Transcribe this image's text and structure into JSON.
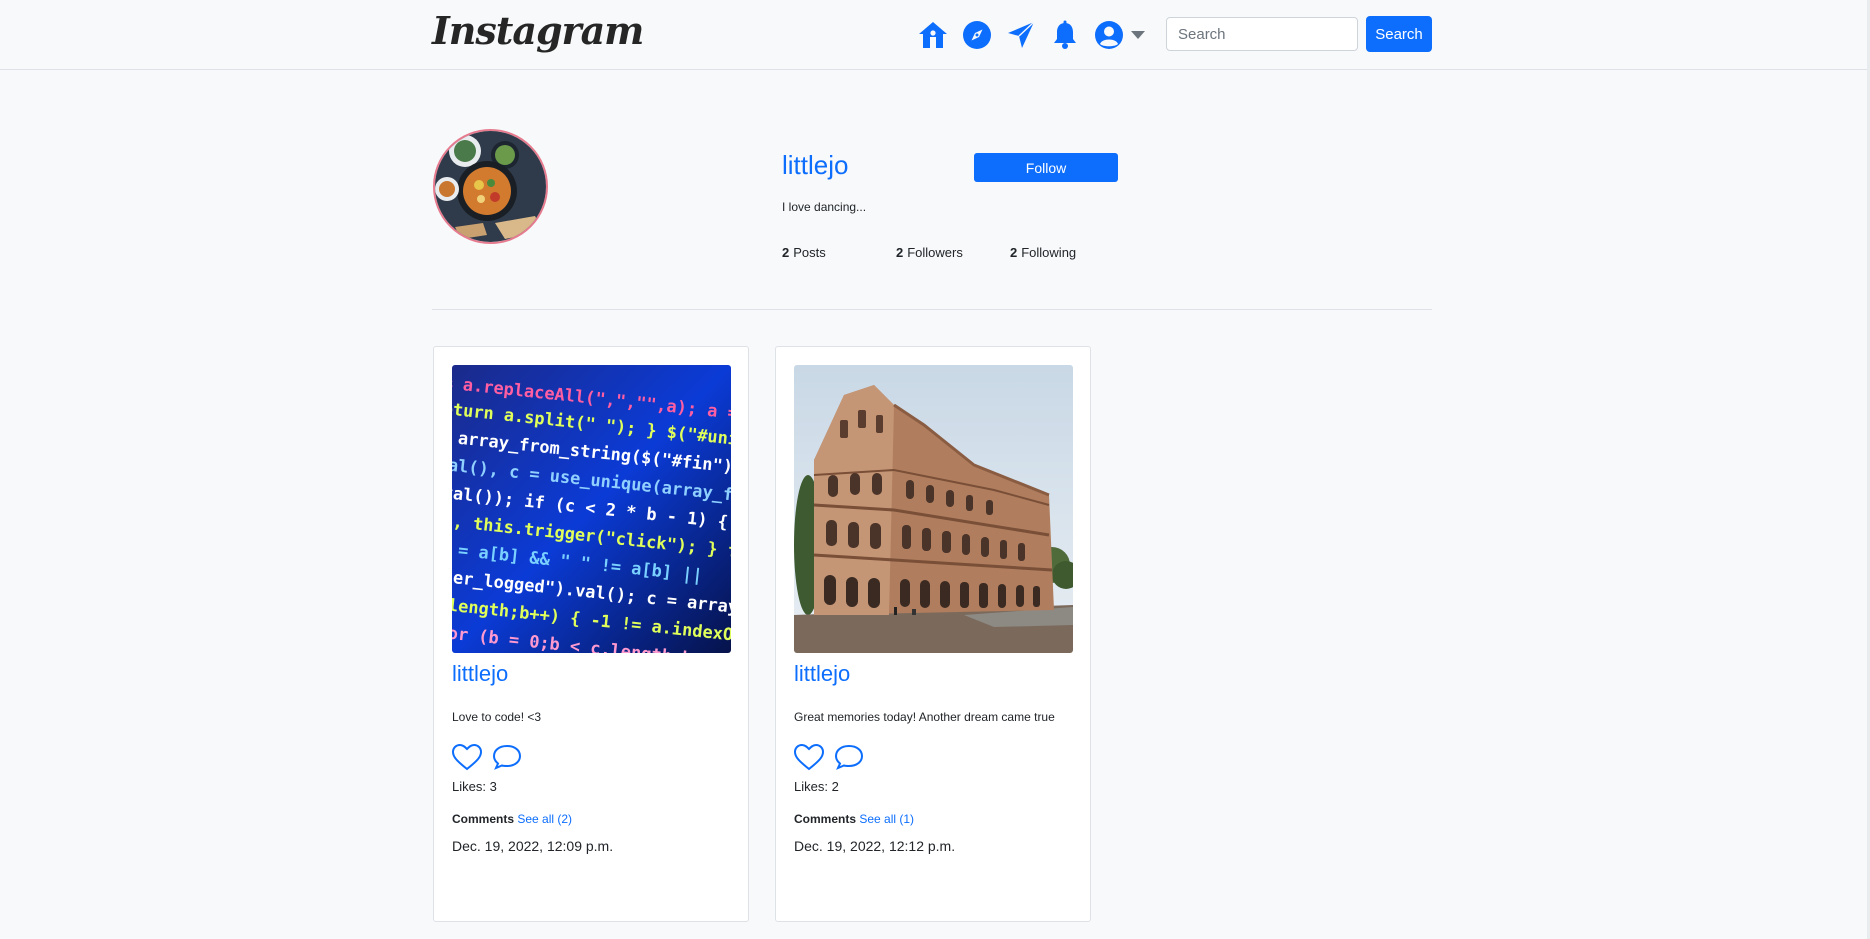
{
  "header": {
    "logo": "Instagram",
    "icons": [
      "home-icon",
      "explore-icon",
      "send-icon",
      "notifications-icon",
      "profile-icon",
      "caret-down-icon"
    ],
    "search_placeholder": "Search",
    "search_button": "Search",
    "accent": "#0d6efd"
  },
  "profile": {
    "username": "littlejo",
    "follow_label": "Follow",
    "bio": "I love dancing...",
    "stats": {
      "posts_count": "2",
      "posts_label": "Posts",
      "followers_count": "2",
      "followers_label": "Followers",
      "following_count": "2",
      "following_label": "Following"
    }
  },
  "posts": [
    {
      "username": "littlejo",
      "caption": "Love to code! <3",
      "likes": "Likes: 3",
      "comments_label": "Comments",
      "see_all": "See all (2)",
      "date": "Dec. 19, 2022, 12:09 p.m."
    },
    {
      "username": "littlejo",
      "caption": "Great memories today! Another dream came true",
      "likes": "Likes: 2",
      "comments_label": "Comments",
      "see_all": "See all (1)",
      "date": "Dec. 19, 2022, 12:12 p.m."
    }
  ],
  "colors": {
    "accent": "#0d6efd",
    "avatar_ring": "#e67a8e"
  }
}
